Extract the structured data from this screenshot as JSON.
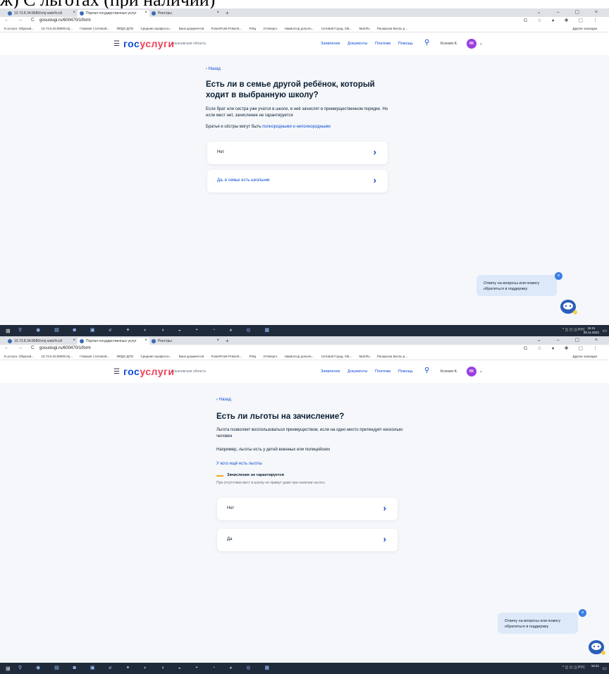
{
  "top_heading": "ж) С льготах (при наличии)",
  "browser": {
    "tabs": [
      "10.73.8.34:8080/cmj-web/#coll",
      "Портал государственных услуг",
      "Реестры"
    ],
    "shot1_url": "gosuslugi.ru/600470/1/form",
    "shot2_url": "gosuslugi.ru/600470/1/form",
    "bookmarks": [
      "Е-услуги. Образов...",
      "10.73.8.34:8080/cmj...",
      "Главная | Сетевой...",
      "ФРДО ДПО",
      "Средние професси...",
      "Банк документов",
      "PowerPoint-Präsent...",
      "РИЦ",
      "УлЭнерго",
      "Навигатор дополн...",
      "Сетевой Город. ОБ...",
      "Mail.Ru",
      "Раскраска Белль р..."
    ],
    "other_bookmarks": "Другие закладки"
  },
  "header": {
    "logo_part1": "гос",
    "logo_part2": "услуги",
    "region": "Ульяновская область",
    "menu": [
      "Заявления",
      "Документы",
      "Платежи",
      "Помощь"
    ],
    "user_name": "Ксения К.",
    "avatar_initials": "КК"
  },
  "screen1": {
    "back": "‹ Назад",
    "title": "Есть ли в семье другой ребёнок, который ходит в выбранную школу?",
    "desc": "Если брат или сестра уже учатся в школе, в неё зачислят в преимущественном порядке. Но если мест нет, зачисление не гарантируется",
    "siblings_prefix": "Братья и сёстры могут быть ",
    "siblings_link": "полнородными и неполнородными",
    "option1": "Нет",
    "option2": "Да, в семье есть школьник"
  },
  "screen2": {
    "back": "‹ Назад",
    "title": "Есть ли льготы на зачисление?",
    "desc": "Льгота позволяет воспользоваться преимуществом, если на одно место претендует несколько человек",
    "example": "Например, льготы есть у детей военных или полицейских",
    "link": "У кого ещё есть льготы",
    "warn_title": "Зачисление не гарантируется",
    "warn_sub": "При отсутствии мест в школу не примут даже при наличии льготы",
    "option1": "Нет",
    "option2": "Да"
  },
  "support_bubble": "Отвечу на вопросы или помогу обратиться в поддержку",
  "taskbar": {
    "tray": "РУС",
    "time": "15:21",
    "date": "28.11.2022"
  },
  "colors": {
    "brand_blue": "#0d4cd3",
    "brand_red": "#ee3f58",
    "page_bg": "#f5f7fa",
    "warning": "#f5a623"
  }
}
